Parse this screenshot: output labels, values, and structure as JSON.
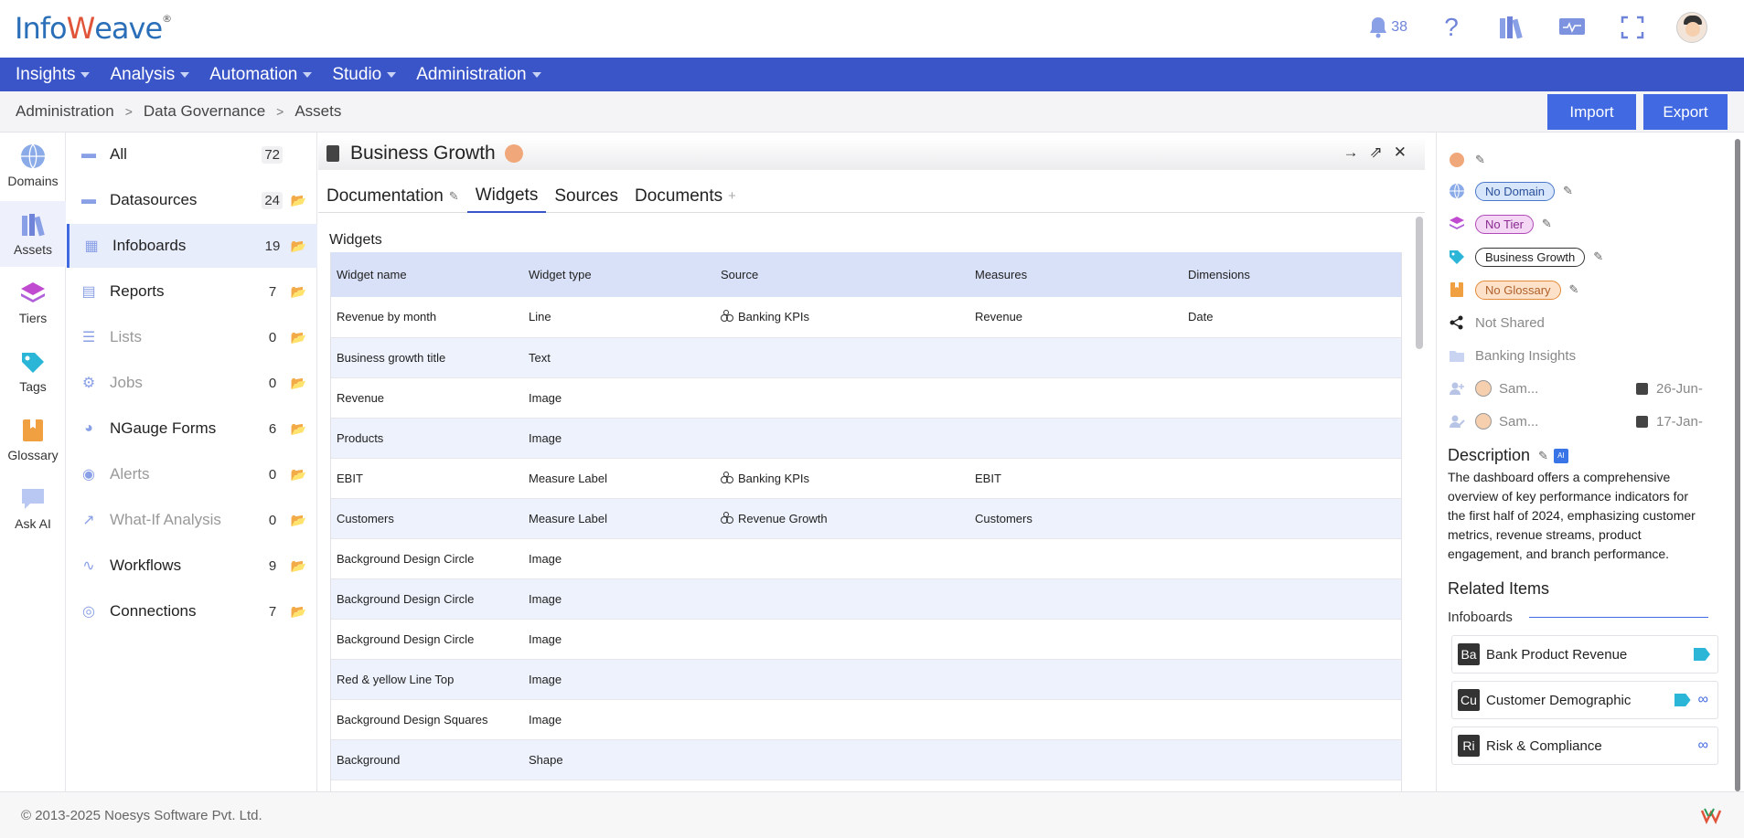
{
  "header": {
    "logo_text": "Infoweave",
    "notification_count": "38"
  },
  "nav": {
    "items": [
      "Insights",
      "Analysis",
      "Automation",
      "Studio",
      "Administration"
    ]
  },
  "breadcrumb": [
    "Administration",
    "Data Governance",
    "Assets"
  ],
  "actions": {
    "import": "Import",
    "export": "Export"
  },
  "rail": [
    {
      "label": "Domains",
      "icon": "globe-icon"
    },
    {
      "label": "Assets",
      "icon": "books-icon"
    },
    {
      "label": "Tiers",
      "icon": "layers-icon"
    },
    {
      "label": "Tags",
      "icon": "tag-icon"
    },
    {
      "label": "Glossary",
      "icon": "bookmark-icon"
    },
    {
      "label": "Ask AI",
      "icon": "chat-icon"
    }
  ],
  "categories": [
    {
      "label": "All",
      "count": "72",
      "icon": "database-icon"
    },
    {
      "label": "Datasources",
      "count": "24",
      "icon": "database-icon"
    },
    {
      "label": "Infoboards",
      "count": "19",
      "icon": "infoboard-icon"
    },
    {
      "label": "Reports",
      "count": "7",
      "icon": "report-icon"
    },
    {
      "label": "Lists",
      "count": "0",
      "icon": "list-icon"
    },
    {
      "label": "Jobs",
      "count": "0",
      "icon": "gears-icon"
    },
    {
      "label": "NGauge Forms",
      "count": "6",
      "icon": "gauge-icon"
    },
    {
      "label": "Alerts",
      "count": "0",
      "icon": "bell-icon"
    },
    {
      "label": "What-If Analysis",
      "count": "0",
      "icon": "chart-line-icon"
    },
    {
      "label": "Workflows",
      "count": "9",
      "icon": "workflow-icon"
    },
    {
      "label": "Connections",
      "count": "7",
      "icon": "globe-icon"
    }
  ],
  "main": {
    "title": "Business Growth",
    "tabs": [
      "Documentation",
      "Widgets",
      "Sources",
      "Documents"
    ],
    "section_title": "Widgets",
    "columns": [
      "Widget name",
      "Widget type",
      "Source",
      "Measures",
      "Dimensions"
    ],
    "rows": [
      [
        "Revenue by month",
        "Line",
        "Banking KPIs",
        "Revenue",
        "Date"
      ],
      [
        "Business growth title",
        "Text",
        "",
        "",
        ""
      ],
      [
        "Revenue",
        "Image",
        "",
        "",
        ""
      ],
      [
        "Products",
        "Image",
        "",
        "",
        ""
      ],
      [
        "EBIT",
        "Measure Label",
        "Banking KPIs",
        "EBIT",
        ""
      ],
      [
        "Customers",
        "Measure Label",
        "Revenue Growth",
        "Customers",
        ""
      ],
      [
        "Background Design Circle",
        "Image",
        "",
        "",
        ""
      ],
      [
        "Background Design Circle",
        "Image",
        "",
        "",
        ""
      ],
      [
        "Background Design Circle",
        "Image",
        "",
        "",
        ""
      ],
      [
        "Red & yellow Line Top",
        "Image",
        "",
        "",
        ""
      ],
      [
        "Background Design Squares",
        "Image",
        "",
        "",
        ""
      ],
      [
        "Background",
        "Shape",
        "",
        "",
        ""
      ]
    ]
  },
  "details": {
    "domain": "No Domain",
    "tier": "No Tier",
    "tag": "Business Growth",
    "glossary": "No Glossary",
    "shared": "Not Shared",
    "folder": "Banking Insights",
    "created_by": "Sam...",
    "created_on": "26-Jun-",
    "modified_by": "Sam...",
    "modified_on": "17-Jan-",
    "description_title": "Description",
    "ai_label": "AI",
    "description": "The dashboard offers a comprehensive overview of key performance indicators for the first half of 2024, emphasizing customer metrics, revenue streams, product engagement, and branch performance.",
    "related_title": "Related Items",
    "related_sub": "Infoboards",
    "related": [
      {
        "badge": "Ba",
        "label": "Bank Product Revenue"
      },
      {
        "badge": "Cu",
        "label": "Customer Demographic"
      },
      {
        "badge": "Ri",
        "label": "Risk & Compliance"
      }
    ]
  },
  "footer": {
    "copyright": "© 2013-2025 Noesys Software Pvt. Ltd."
  },
  "colors": {
    "brand": "#3a55c8",
    "accent": "#4169e1",
    "header_row": "#d9e1f9"
  }
}
